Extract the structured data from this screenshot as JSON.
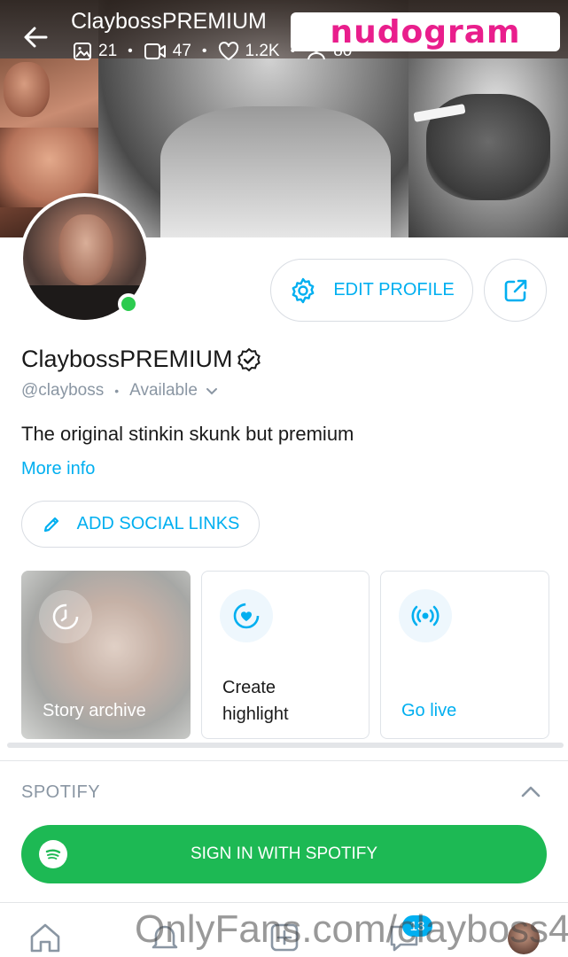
{
  "header": {
    "title": "ClaybossPREMIUM",
    "stats": {
      "photos": "21",
      "videos": "47",
      "likes": "1.2K",
      "fans": "80"
    },
    "watermark": "nudogram"
  },
  "profile": {
    "name": "ClaybossPREMIUM",
    "handle": "@clayboss",
    "status": "Available",
    "bio": "The original stinkin skunk but premium",
    "more_info_label": "More info",
    "edit_profile_label": "EDIT PROFILE",
    "add_social_label": "ADD SOCIAL LINKS",
    "online": true
  },
  "highlights": {
    "story_archive_label": "Story archive",
    "create_highlight_label": "Create highlight",
    "go_live_label": "Go live"
  },
  "spotify": {
    "section_title": "SPOTIFY",
    "sign_in_label": "SIGN IN WITH SPOTIFY"
  },
  "nav": {
    "messages_badge": "13",
    "watermark": "OnlyFans.com/clayboss4"
  },
  "colors": {
    "accent": "#00aff0",
    "spotify_green": "#1db954",
    "online_green": "#2ccb4f",
    "muted_text": "#8a96a3",
    "watermark_pink": "#e91e8c"
  },
  "icons": [
    "back-arrow-icon",
    "image-icon",
    "video-icon",
    "heart-icon",
    "fans-icon",
    "gear-icon",
    "share-icon",
    "verified-icon",
    "chevron-down-icon",
    "pencil-icon",
    "clock-icon",
    "highlight-heart-icon",
    "broadcast-icon",
    "chevron-up-icon",
    "spotify-icon",
    "home-icon",
    "bell-icon",
    "add-post-icon",
    "message-icon"
  ]
}
